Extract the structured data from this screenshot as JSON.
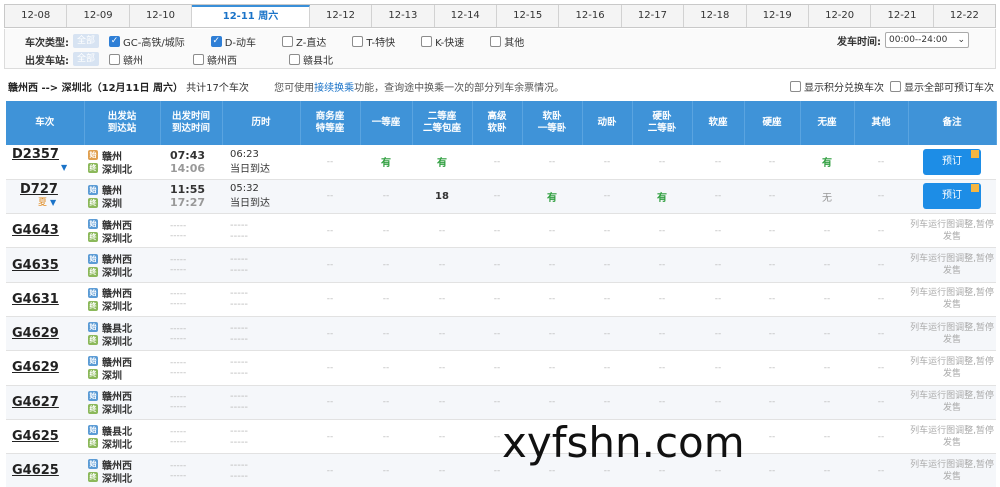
{
  "dates": [
    "12-08",
    "12-09",
    "12-10",
    "12-11 周六",
    "12-12",
    "12-13",
    "12-14",
    "12-15",
    "12-16",
    "12-17",
    "12-18",
    "12-19",
    "12-20",
    "12-21",
    "12-22"
  ],
  "active_date_index": 3,
  "filter": {
    "train_type_label": "车次类型:",
    "all_chip": "全部",
    "types": [
      {
        "label": "GC-高铁/城际",
        "checked": true
      },
      {
        "label": "D-动车",
        "checked": true
      },
      {
        "label": "Z-直达",
        "checked": false
      },
      {
        "label": "T-特快",
        "checked": false
      },
      {
        "label": "K-快速",
        "checked": false
      },
      {
        "label": "其他",
        "checked": false
      }
    ],
    "station_label": "出发车站:",
    "stations": [
      {
        "label": "赣州",
        "checked": false
      },
      {
        "label": "赣州西",
        "checked": false
      },
      {
        "label": "赣县北",
        "checked": false
      }
    ],
    "time_label": "发车时间:",
    "time_value": "00:00--24:00"
  },
  "summary": {
    "route": "赣州西 --> 深圳北（12月11日 周六）",
    "count_text": "共计17个车次",
    "hint_pre": "您可使用",
    "hint_link": "接续换乘",
    "hint_post": "功能，查询途中换乘一次的部分列车余票情况。",
    "opt1": "显示积分兑换车次",
    "opt2": "显示全部可预订车次"
  },
  "headers": [
    "车次",
    "出发站\n到达站",
    "出发时间\n到达时间",
    "历时",
    "商务座\n特等座",
    "一等座",
    "二等座\n二等包座",
    "高级\n软卧",
    "软卧\n一等卧",
    "动卧",
    "硬卧\n二等卧",
    "软座",
    "硬座",
    "无座",
    "其他",
    "备注"
  ],
  "rows": [
    {
      "train": "D2357",
      "extra": "",
      "from": "赣州",
      "to": "深圳北",
      "from_badge": "b-orange",
      "dep": "07:43",
      "arr": "14:06",
      "dur": "06:23",
      "day": "当日到达",
      "seats": [
        "--",
        "有",
        "有",
        "--",
        "--",
        "--",
        "--",
        "--",
        "--",
        "有",
        "--"
      ],
      "remark": "预订",
      "bookable": true
    },
    {
      "train": "D727",
      "extra": "夏",
      "from": "赣州",
      "to": "深圳",
      "from_badge": "b-start",
      "dep": "11:55",
      "arr": "17:27",
      "dur": "05:32",
      "day": "当日到达",
      "seats": [
        "--",
        "--",
        "18",
        "--",
        "有",
        "--",
        "有",
        "--",
        "--",
        "无",
        "--"
      ],
      "remark": "预订",
      "bookable": true
    },
    {
      "train": "G4643",
      "extra": "",
      "from": "赣州西",
      "to": "深圳北",
      "from_badge": "b-start",
      "dep": "-----",
      "arr": "-----",
      "dur": "-----",
      "day": "-----",
      "seats": [
        "--",
        "--",
        "--",
        "--",
        "--",
        "--",
        "--",
        "--",
        "--",
        "--",
        "--"
      ],
      "remark": "列车运行图调整,暂停发售",
      "bookable": false
    },
    {
      "train": "G4635",
      "extra": "",
      "from": "赣州西",
      "to": "深圳北",
      "from_badge": "b-start",
      "dep": "-----",
      "arr": "-----",
      "dur": "-----",
      "day": "-----",
      "seats": [
        "--",
        "--",
        "--",
        "--",
        "--",
        "--",
        "--",
        "--",
        "--",
        "--",
        "--"
      ],
      "remark": "列车运行图调整,暂停发售",
      "bookable": false
    },
    {
      "train": "G4631",
      "extra": "",
      "from": "赣州西",
      "to": "深圳北",
      "from_badge": "b-start",
      "dep": "-----",
      "arr": "-----",
      "dur": "-----",
      "day": "-----",
      "seats": [
        "--",
        "--",
        "--",
        "--",
        "--",
        "--",
        "--",
        "--",
        "--",
        "--",
        "--"
      ],
      "remark": "列车运行图调整,暂停发售",
      "bookable": false
    },
    {
      "train": "G4629",
      "extra": "",
      "from": "赣县北",
      "to": "深圳北",
      "from_badge": "b-start",
      "dep": "-----",
      "arr": "-----",
      "dur": "-----",
      "day": "-----",
      "seats": [
        "--",
        "--",
        "--",
        "--",
        "--",
        "--",
        "--",
        "--",
        "--",
        "--",
        "--"
      ],
      "remark": "列车运行图调整,暂停发售",
      "bookable": false
    },
    {
      "train": "G4629",
      "extra": "",
      "from": "赣州西",
      "to": "深圳",
      "from_badge": "b-start",
      "dep": "-----",
      "arr": "-----",
      "dur": "-----",
      "day": "-----",
      "seats": [
        "--",
        "--",
        "--",
        "--",
        "--",
        "--",
        "--",
        "--",
        "--",
        "--",
        "--"
      ],
      "remark": "列车运行图调整,暂停发售",
      "bookable": false
    },
    {
      "train": "G4627",
      "extra": "",
      "from": "赣州西",
      "to": "深圳北",
      "from_badge": "b-start",
      "dep": "-----",
      "arr": "-----",
      "dur": "-----",
      "day": "-----",
      "seats": [
        "--",
        "--",
        "--",
        "--",
        "--",
        "--",
        "--",
        "--",
        "--",
        "--",
        "--"
      ],
      "remark": "列车运行图调整,暂停发售",
      "bookable": false
    },
    {
      "train": "G4625",
      "extra": "",
      "from": "赣县北",
      "to": "深圳北",
      "from_badge": "b-start",
      "dep": "-----",
      "arr": "-----",
      "dur": "-----",
      "day": "-----",
      "seats": [
        "--",
        "--",
        "--",
        "--",
        "--",
        "--",
        "--",
        "--",
        "--",
        "--",
        "--"
      ],
      "remark": "列车运行图调整,暂停发售",
      "bookable": false
    },
    {
      "train": "G4625",
      "extra": "",
      "from": "赣州西",
      "to": "深圳北",
      "from_badge": "b-start",
      "dep": "-----",
      "arr": "-----",
      "dur": "-----",
      "day": "-----",
      "seats": [
        "--",
        "--",
        "--",
        "--",
        "--",
        "--",
        "--",
        "--",
        "--",
        "--",
        "--"
      ],
      "remark": "列车运行图调整,暂停发售",
      "bookable": false
    }
  ],
  "watermark": "xyfshn.com"
}
